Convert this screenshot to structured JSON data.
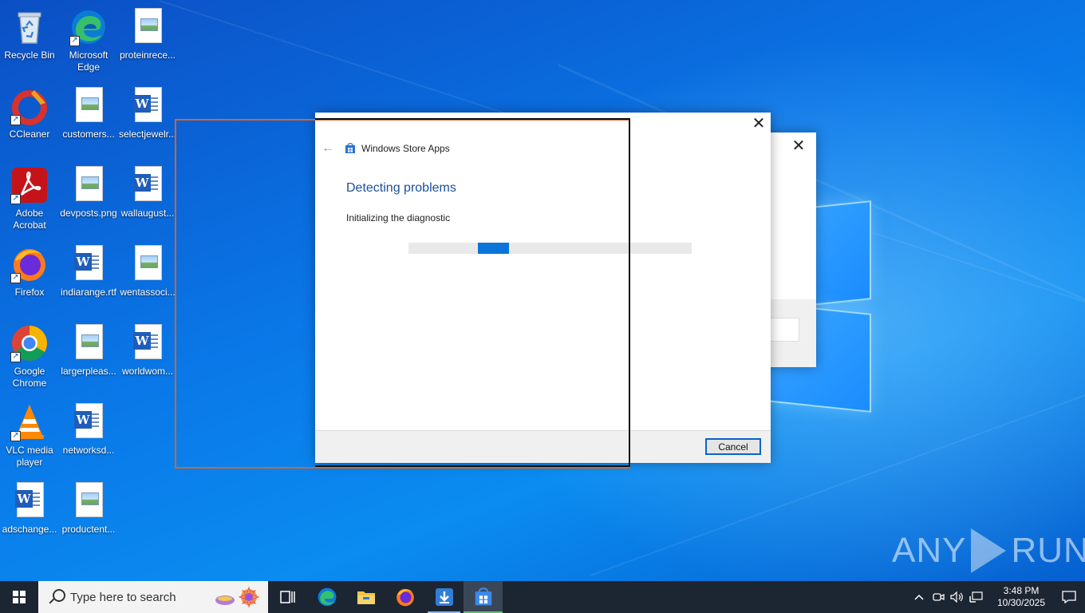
{
  "desktop": {
    "icons": [
      {
        "label": "Recycle Bin",
        "icon": "recycle-bin-icon"
      },
      {
        "label": "Microsoft Edge",
        "icon": "edge-icon"
      },
      {
        "label": "proteinrece...",
        "icon": "image-file-icon"
      },
      {
        "label": "CCleaner",
        "icon": "ccleaner-icon"
      },
      {
        "label": "customers...",
        "icon": "image-file-icon"
      },
      {
        "label": "selectjewelr...",
        "icon": "word-doc-icon"
      },
      {
        "label": "Adobe Acrobat",
        "icon": "acrobat-icon"
      },
      {
        "label": "devposts.png",
        "icon": "image-file-icon"
      },
      {
        "label": "wallaugust...",
        "icon": "word-doc-icon"
      },
      {
        "label": "Firefox",
        "icon": "firefox-icon"
      },
      {
        "label": "indiarange.rtf",
        "icon": "word-doc-icon"
      },
      {
        "label": "wentassoci...",
        "icon": "image-file-icon"
      },
      {
        "label": "Google Chrome",
        "icon": "chrome-icon"
      },
      {
        "label": "largerpleas...",
        "icon": "image-file-icon"
      },
      {
        "label": "worldwom...",
        "icon": "word-doc-icon"
      },
      {
        "label": "VLC media player",
        "icon": "vlc-icon"
      },
      {
        "label": "networksd...",
        "icon": "word-doc-icon"
      },
      {
        "label": "adschange...",
        "icon": "word-doc-icon"
      },
      {
        "label": "productent...",
        "icon": "image-file-icon"
      }
    ]
  },
  "dialog": {
    "app_title": "Windows Store Apps",
    "heading": "Detecting problems",
    "status": "Initializing the diagnostic",
    "cancel_label": "Cancel",
    "close_glyph": "✕",
    "back_glyph": "←"
  },
  "back_window": {
    "close_glyph": "✕"
  },
  "watermark": {
    "left": "ANY",
    "right": "RUN"
  },
  "taskbar": {
    "search_placeholder": "Type here to search",
    "apps": [
      "task-view-icon",
      "edge-icon",
      "file-explorer-icon",
      "firefox-icon",
      "downloader-icon",
      "store-troubleshooter-icon"
    ],
    "clock_time": "3:48 PM",
    "clock_date": "10/30/2025"
  },
  "colors": {
    "accent": "#0a74d8",
    "heading": "#1b4f9c",
    "highlight_outer": "#d3642f",
    "highlight_inner": "#111111",
    "taskbar": "#1c2532"
  }
}
